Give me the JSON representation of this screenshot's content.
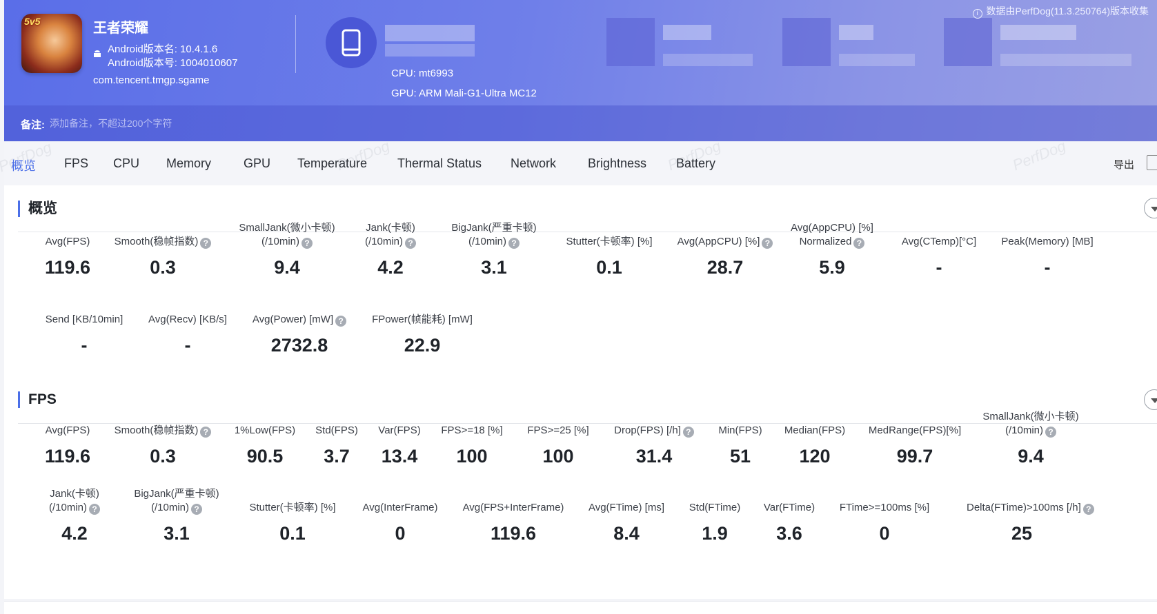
{
  "app": {
    "title": "王者荣耀",
    "version_name": "Android版本名: 10.4.1.6",
    "version_code": "Android版本号: 1004010607",
    "package": "com.tencent.tmgp.sgame",
    "icon_badge": "5v5"
  },
  "device": {
    "cpu": "CPU: mt6993",
    "gpu": "GPU: ARM Mali-G1-Ultra MC12"
  },
  "source_note": "数据由PerfDog(11.3.250764)版本收集",
  "notes": {
    "label": "备注:",
    "placeholder": "添加备注，不超过200个字符"
  },
  "tabs": [
    "概览",
    "FPS",
    "CPU",
    "Memory",
    "GPU",
    "Temperature",
    "Thermal Status",
    "Network",
    "Brightness",
    "Battery"
  ],
  "active_tab": 0,
  "export_label": "导出",
  "watermark": "PerfDog",
  "overview": {
    "title": "概览",
    "metrics": [
      {
        "label": "Avg(FPS)",
        "value": "119.6"
      },
      {
        "label": "Smooth(稳帧指数)",
        "value": "0.3",
        "help": true
      },
      {
        "label": "SmallJank(微小卡顿)",
        "label2": "(/10min)",
        "value": "9.4",
        "help": true
      },
      {
        "label": "Jank(卡顿)",
        "label2": "(/10min)",
        "value": "4.2",
        "help": true
      },
      {
        "label": "BigJank(严重卡顿)",
        "label2": "(/10min)",
        "value": "3.1",
        "help": true
      },
      {
        "label": "Stutter(卡顿率) [%]",
        "value": "0.1"
      },
      {
        "label": "Avg(AppCPU) [%]",
        "value": "28.7",
        "help": true
      },
      {
        "label": "Avg(AppCPU) [%]",
        "label2": "Normalized",
        "value": "5.9",
        "help": true
      },
      {
        "label": "Avg(CTemp)[°C]",
        "value": "-"
      },
      {
        "label": "Peak(Memory) [MB]",
        "value": "-"
      },
      {
        "label": "Send [KB/10min]",
        "value": "-"
      },
      {
        "label": "Avg(Recv) [KB/s]",
        "value": "-"
      },
      {
        "label": "Avg(Power) [mW]",
        "value": "2732.8",
        "help": true
      },
      {
        "label": "FPower(帧能耗) [mW]",
        "value": "22.9"
      }
    ]
  },
  "fps": {
    "title": "FPS",
    "metrics": [
      {
        "label": "Avg(FPS)",
        "value": "119.6"
      },
      {
        "label": "Smooth(稳帧指数)",
        "value": "0.3",
        "help": true
      },
      {
        "label": "1%Low(FPS)",
        "value": "90.5"
      },
      {
        "label": "Std(FPS)",
        "value": "3.7"
      },
      {
        "label": "Var(FPS)",
        "value": "13.4"
      },
      {
        "label": "FPS>=18 [%]",
        "value": "100"
      },
      {
        "label": "FPS>=25 [%]",
        "value": "100"
      },
      {
        "label": "Drop(FPS) [/h]",
        "value": "31.4",
        "help": true
      },
      {
        "label": "Min(FPS)",
        "value": "51"
      },
      {
        "label": "Median(FPS)",
        "value": "120"
      },
      {
        "label": "MedRange(FPS)[%]",
        "value": "99.7"
      },
      {
        "label": "SmallJank(微小卡顿)",
        "label2": "(/10min)",
        "value": "9.4",
        "help": true
      },
      {
        "label": "Jank(卡顿)",
        "label2": "(/10min)",
        "value": "4.2",
        "help": true
      },
      {
        "label": "BigJank(严重卡顿)",
        "label2": "(/10min)",
        "value": "3.1",
        "help": true
      },
      {
        "label": "Stutter(卡顿率) [%]",
        "value": "0.1"
      },
      {
        "label": "Avg(InterFrame)",
        "value": "0"
      },
      {
        "label": "Avg(FPS+InterFrame)",
        "value": "119.6"
      },
      {
        "label": "Avg(FTime) [ms]",
        "value": "8.4"
      },
      {
        "label": "Std(FTime)",
        "value": "1.9"
      },
      {
        "label": "Var(FTime)",
        "value": "3.6"
      },
      {
        "label": "FTime>=100ms [%]",
        "value": "0"
      },
      {
        "label": "Delta(FTime)>100ms [/h]",
        "value": "25",
        "help": true
      }
    ]
  }
}
